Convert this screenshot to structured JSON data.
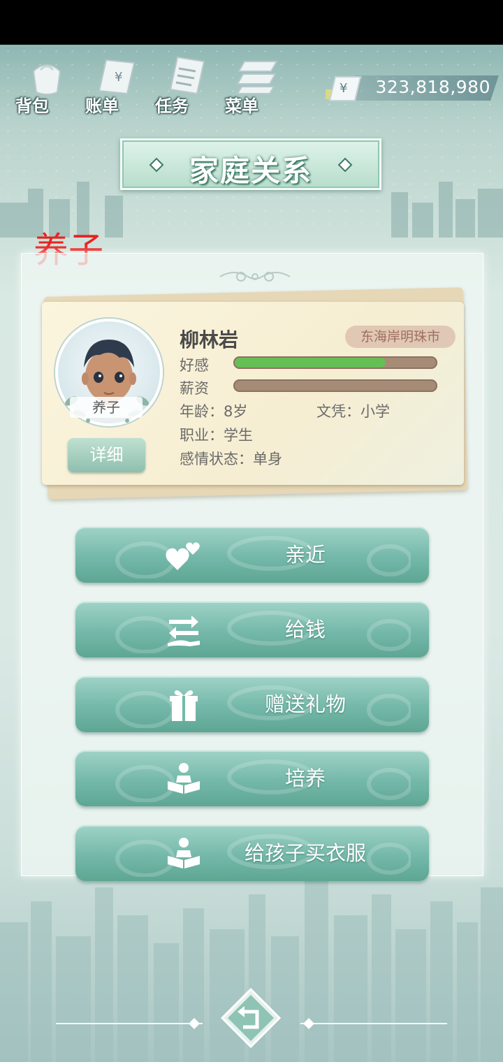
{
  "toolbar": {
    "items": [
      {
        "label": "背包",
        "icon": "bag-icon"
      },
      {
        "label": "账单",
        "icon": "bill-icon"
      },
      {
        "label": "任务",
        "icon": "task-icon"
      },
      {
        "label": "菜单",
        "icon": "menu-icon"
      }
    ]
  },
  "money": {
    "currency_symbol": "¥",
    "value": "323,818,980"
  },
  "title": "家庭关系",
  "relation_label": "养子",
  "character": {
    "name": "柳林岩",
    "avatar_tag": "养子",
    "location": "东海岸明珠市",
    "favor_label": "好感",
    "favor_fraction": 0.75,
    "salary_label": "薪资",
    "salary_fraction": 0,
    "age_text": "年龄：8岁",
    "education_text": "文凭：小学",
    "job_text": "职业：学生",
    "relationship_text": "感情状态：单身",
    "detail_button": "详细"
  },
  "actions": [
    {
      "label": "亲近",
      "icon": "hearts-icon"
    },
    {
      "label": "给钱",
      "icon": "give-money-icon"
    },
    {
      "label": "赠送礼物",
      "icon": "gift-icon"
    },
    {
      "label": "培养",
      "icon": "reading-icon"
    },
    {
      "label": "给孩子买衣服",
      "icon": "reading-icon"
    }
  ],
  "colors": {
    "accent": "#74b8a9",
    "relation_label": "#e8231f",
    "favor_fill": "#66bf55",
    "bar_track": "#a68c77"
  }
}
